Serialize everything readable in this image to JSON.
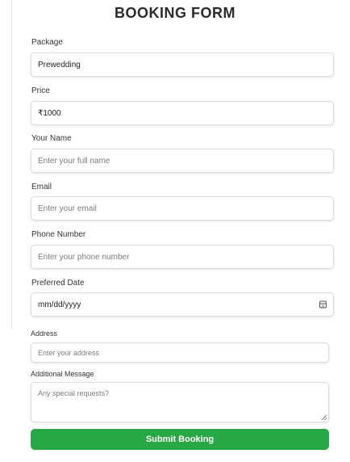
{
  "form": {
    "title": "BOOKING FORM",
    "package": {
      "label": "Package",
      "value": "Prewedding"
    },
    "price": {
      "label": "Price",
      "value": "₹1000"
    },
    "name": {
      "label": "Your Name",
      "placeholder": "Enter your full name"
    },
    "email": {
      "label": "Email",
      "placeholder": "Enter your email"
    },
    "phone": {
      "label": "Phone Number",
      "placeholder": "Enter your phone number"
    },
    "date": {
      "label": "Preferred Date",
      "placeholder": "mm/dd/yyyy",
      "icon": "calendar-icon"
    },
    "address": {
      "label": "Address",
      "placeholder": "Enter your address"
    },
    "message": {
      "label": "Additional Message",
      "placeholder": "Any special requests?"
    },
    "submit_label": "Submit Booking",
    "accent_color": "#28a745"
  }
}
